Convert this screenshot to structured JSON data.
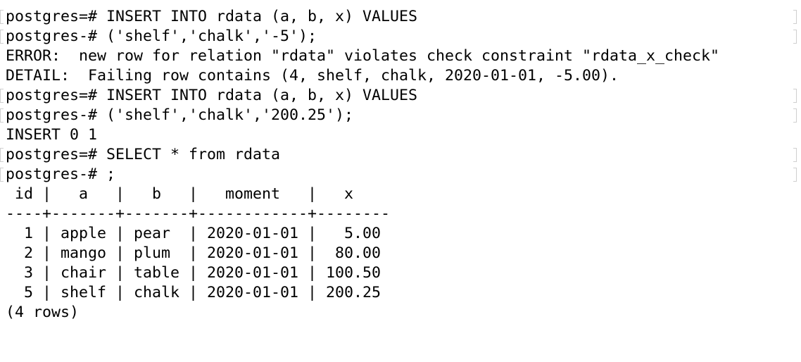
{
  "terminal": {
    "lines": [
      {
        "text": "postgres=# INSERT INTO rdata (a, b, x) VALUES",
        "marked": true
      },
      {
        "text": "postgres-# ('shelf','chalk','-5');",
        "marked": true
      },
      {
        "text": "ERROR:  new row for relation \"rdata\" violates check constraint \"rdata_x_check\"",
        "marked": false
      },
      {
        "text": "DETAIL:  Failing row contains (4, shelf, chalk, 2020-01-01, -5.00).",
        "marked": false
      },
      {
        "text": "postgres=# INSERT INTO rdata (a, b, x) VALUES",
        "marked": true
      },
      {
        "text": "postgres-# ('shelf','chalk','200.25');",
        "marked": true
      },
      {
        "text": "INSERT 0 1",
        "marked": false
      },
      {
        "text": "postgres=# SELECT * from rdata",
        "marked": true
      },
      {
        "text": "postgres-# ;",
        "marked": true
      },
      {
        "text": " id |   a   |   b   |   moment   |   x",
        "marked": false
      },
      {
        "text": "----+-------+-------+------------+--------",
        "marked": false
      },
      {
        "text": "  1 | apple | pear  | 2020-01-01 |   5.00",
        "marked": false
      },
      {
        "text": "  2 | mango | plum  | 2020-01-01 |  80.00",
        "marked": false
      },
      {
        "text": "  3 | chair | table | 2020-01-01 | 100.50",
        "marked": false
      },
      {
        "text": "  5 | shelf | chalk | 2020-01-01 | 200.25",
        "marked": false
      },
      {
        "text": "(4 rows)",
        "marked": false
      }
    ]
  }
}
